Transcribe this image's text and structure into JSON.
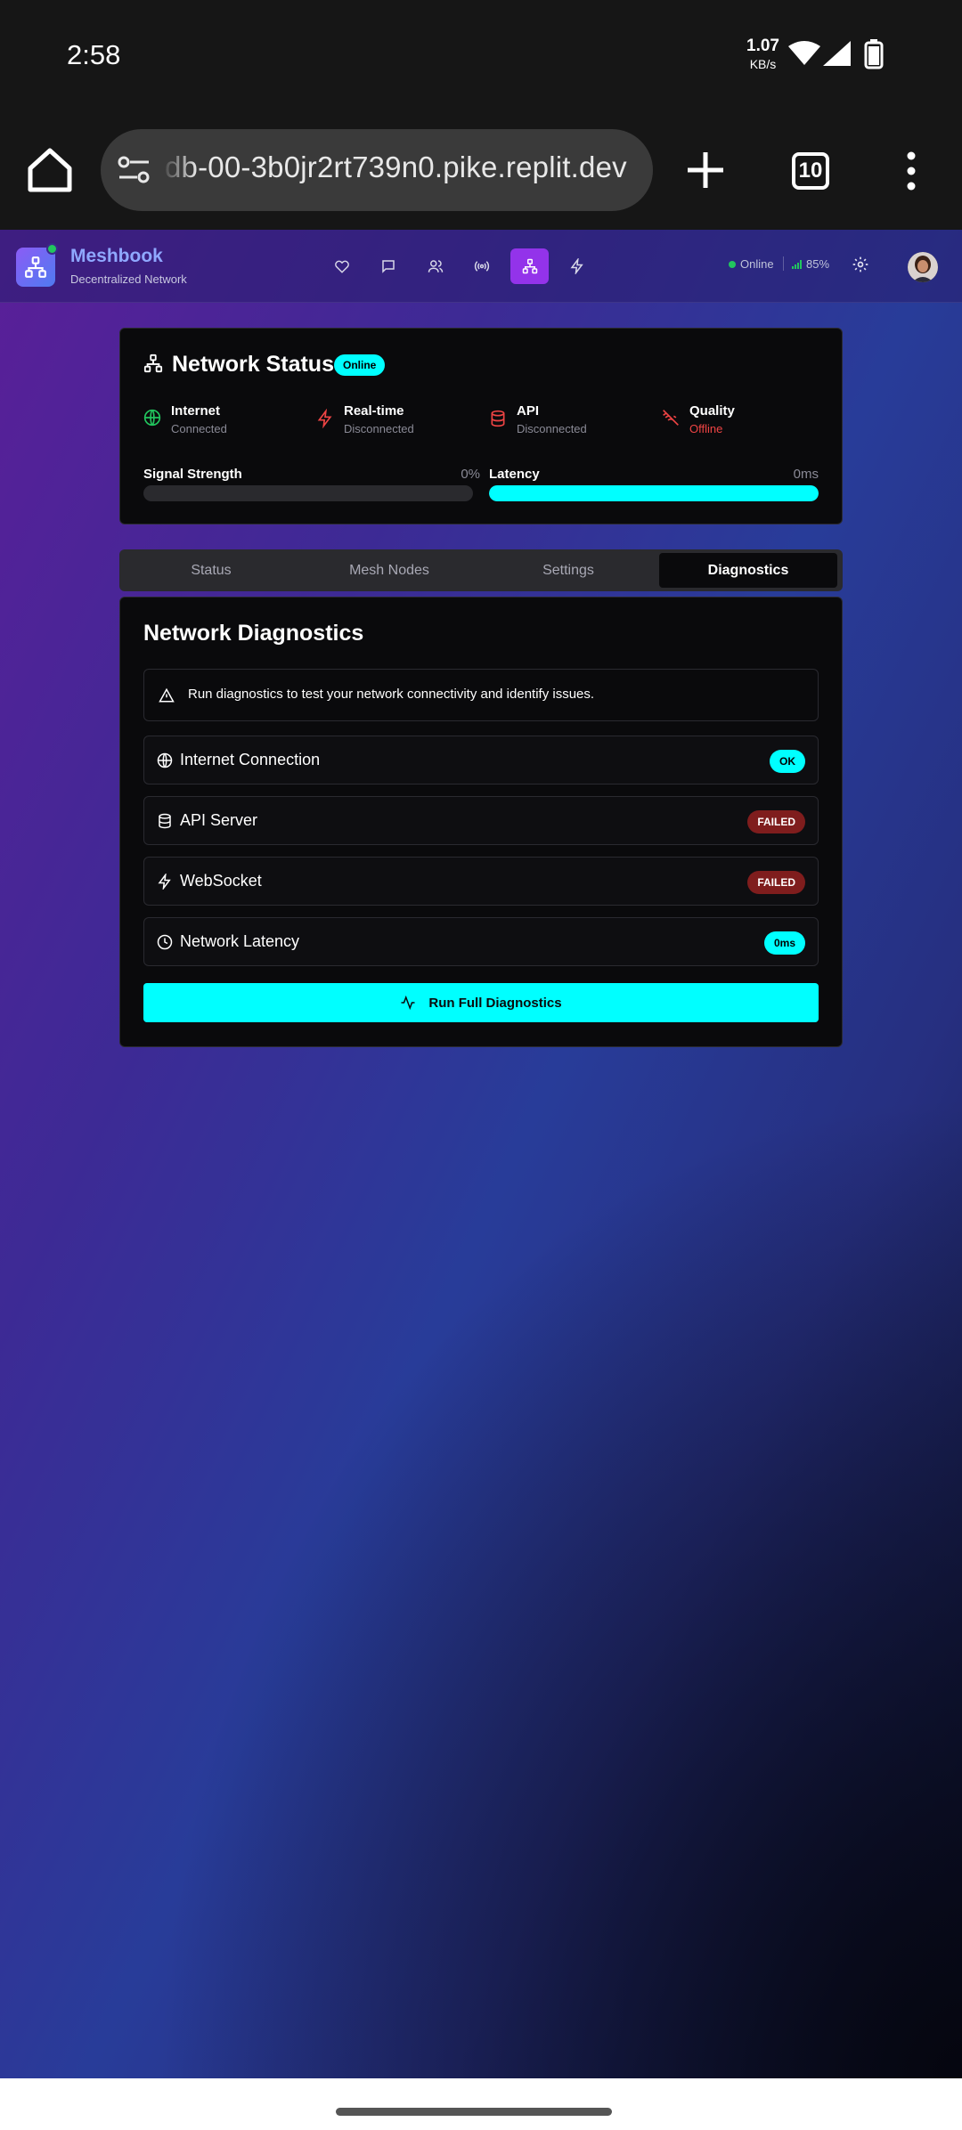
{
  "status_bar": {
    "time": "2:58",
    "speed_value": "1.07",
    "speed_unit": "KB/s"
  },
  "browser": {
    "url": "db-00-3b0jr2rt739n0.pike.replit.dev",
    "tab_count": "10"
  },
  "app": {
    "brand": "Meshbook",
    "brand_sub": "Decentralized Network",
    "online_label": "Online",
    "battery_label": "85%",
    "nav_icons": [
      "heart-icon",
      "message-icon",
      "users-icon",
      "broadcast-icon",
      "network-icon",
      "zap-icon"
    ],
    "active_nav": "network-icon"
  },
  "network_status": {
    "title": "Network Status",
    "badge": "Online",
    "metrics": [
      {
        "label": "Internet",
        "value": "Connected",
        "icon": "globe-icon",
        "color": "#22c55e"
      },
      {
        "label": "Real-time",
        "value": "Disconnected",
        "icon": "zap-icon",
        "color": "#ef4444"
      },
      {
        "label": "API",
        "value": "Disconnected",
        "icon": "database-icon",
        "color": "#ef4444"
      },
      {
        "label": "Quality",
        "value": "Offline",
        "icon": "wifi-off-icon",
        "color": "#ef4444"
      }
    ],
    "signal": {
      "label": "Signal Strength",
      "value": "0%",
      "level": 0
    },
    "latency": {
      "label": "Latency",
      "value": "0ms",
      "level": 1
    }
  },
  "tabs": [
    "Status",
    "Mesh Nodes",
    "Settings",
    "Diagnostics"
  ],
  "active_tab": "Diagnostics",
  "diagnostics": {
    "title": "Network Diagnostics",
    "alert": "Run diagnostics to test your network connectivity and identify issues.",
    "rows": [
      {
        "label": "Internet Connection",
        "status": "OK",
        "icon": "globe-icon"
      },
      {
        "label": "API Server",
        "status": "FAILED",
        "icon": "database-icon"
      },
      {
        "label": "WebSocket",
        "status": "FAILED",
        "icon": "zap-icon"
      },
      {
        "label": "Network Latency",
        "status": "0ms",
        "icon": "clock-icon"
      }
    ],
    "run_button": "Run Full Diagnostics"
  },
  "colors": {
    "accent": "#00ffff",
    "active_nav": "#9333ea",
    "success": "#22c55e",
    "error": "#ef4444",
    "failed_pill": "#7f1d1d"
  }
}
